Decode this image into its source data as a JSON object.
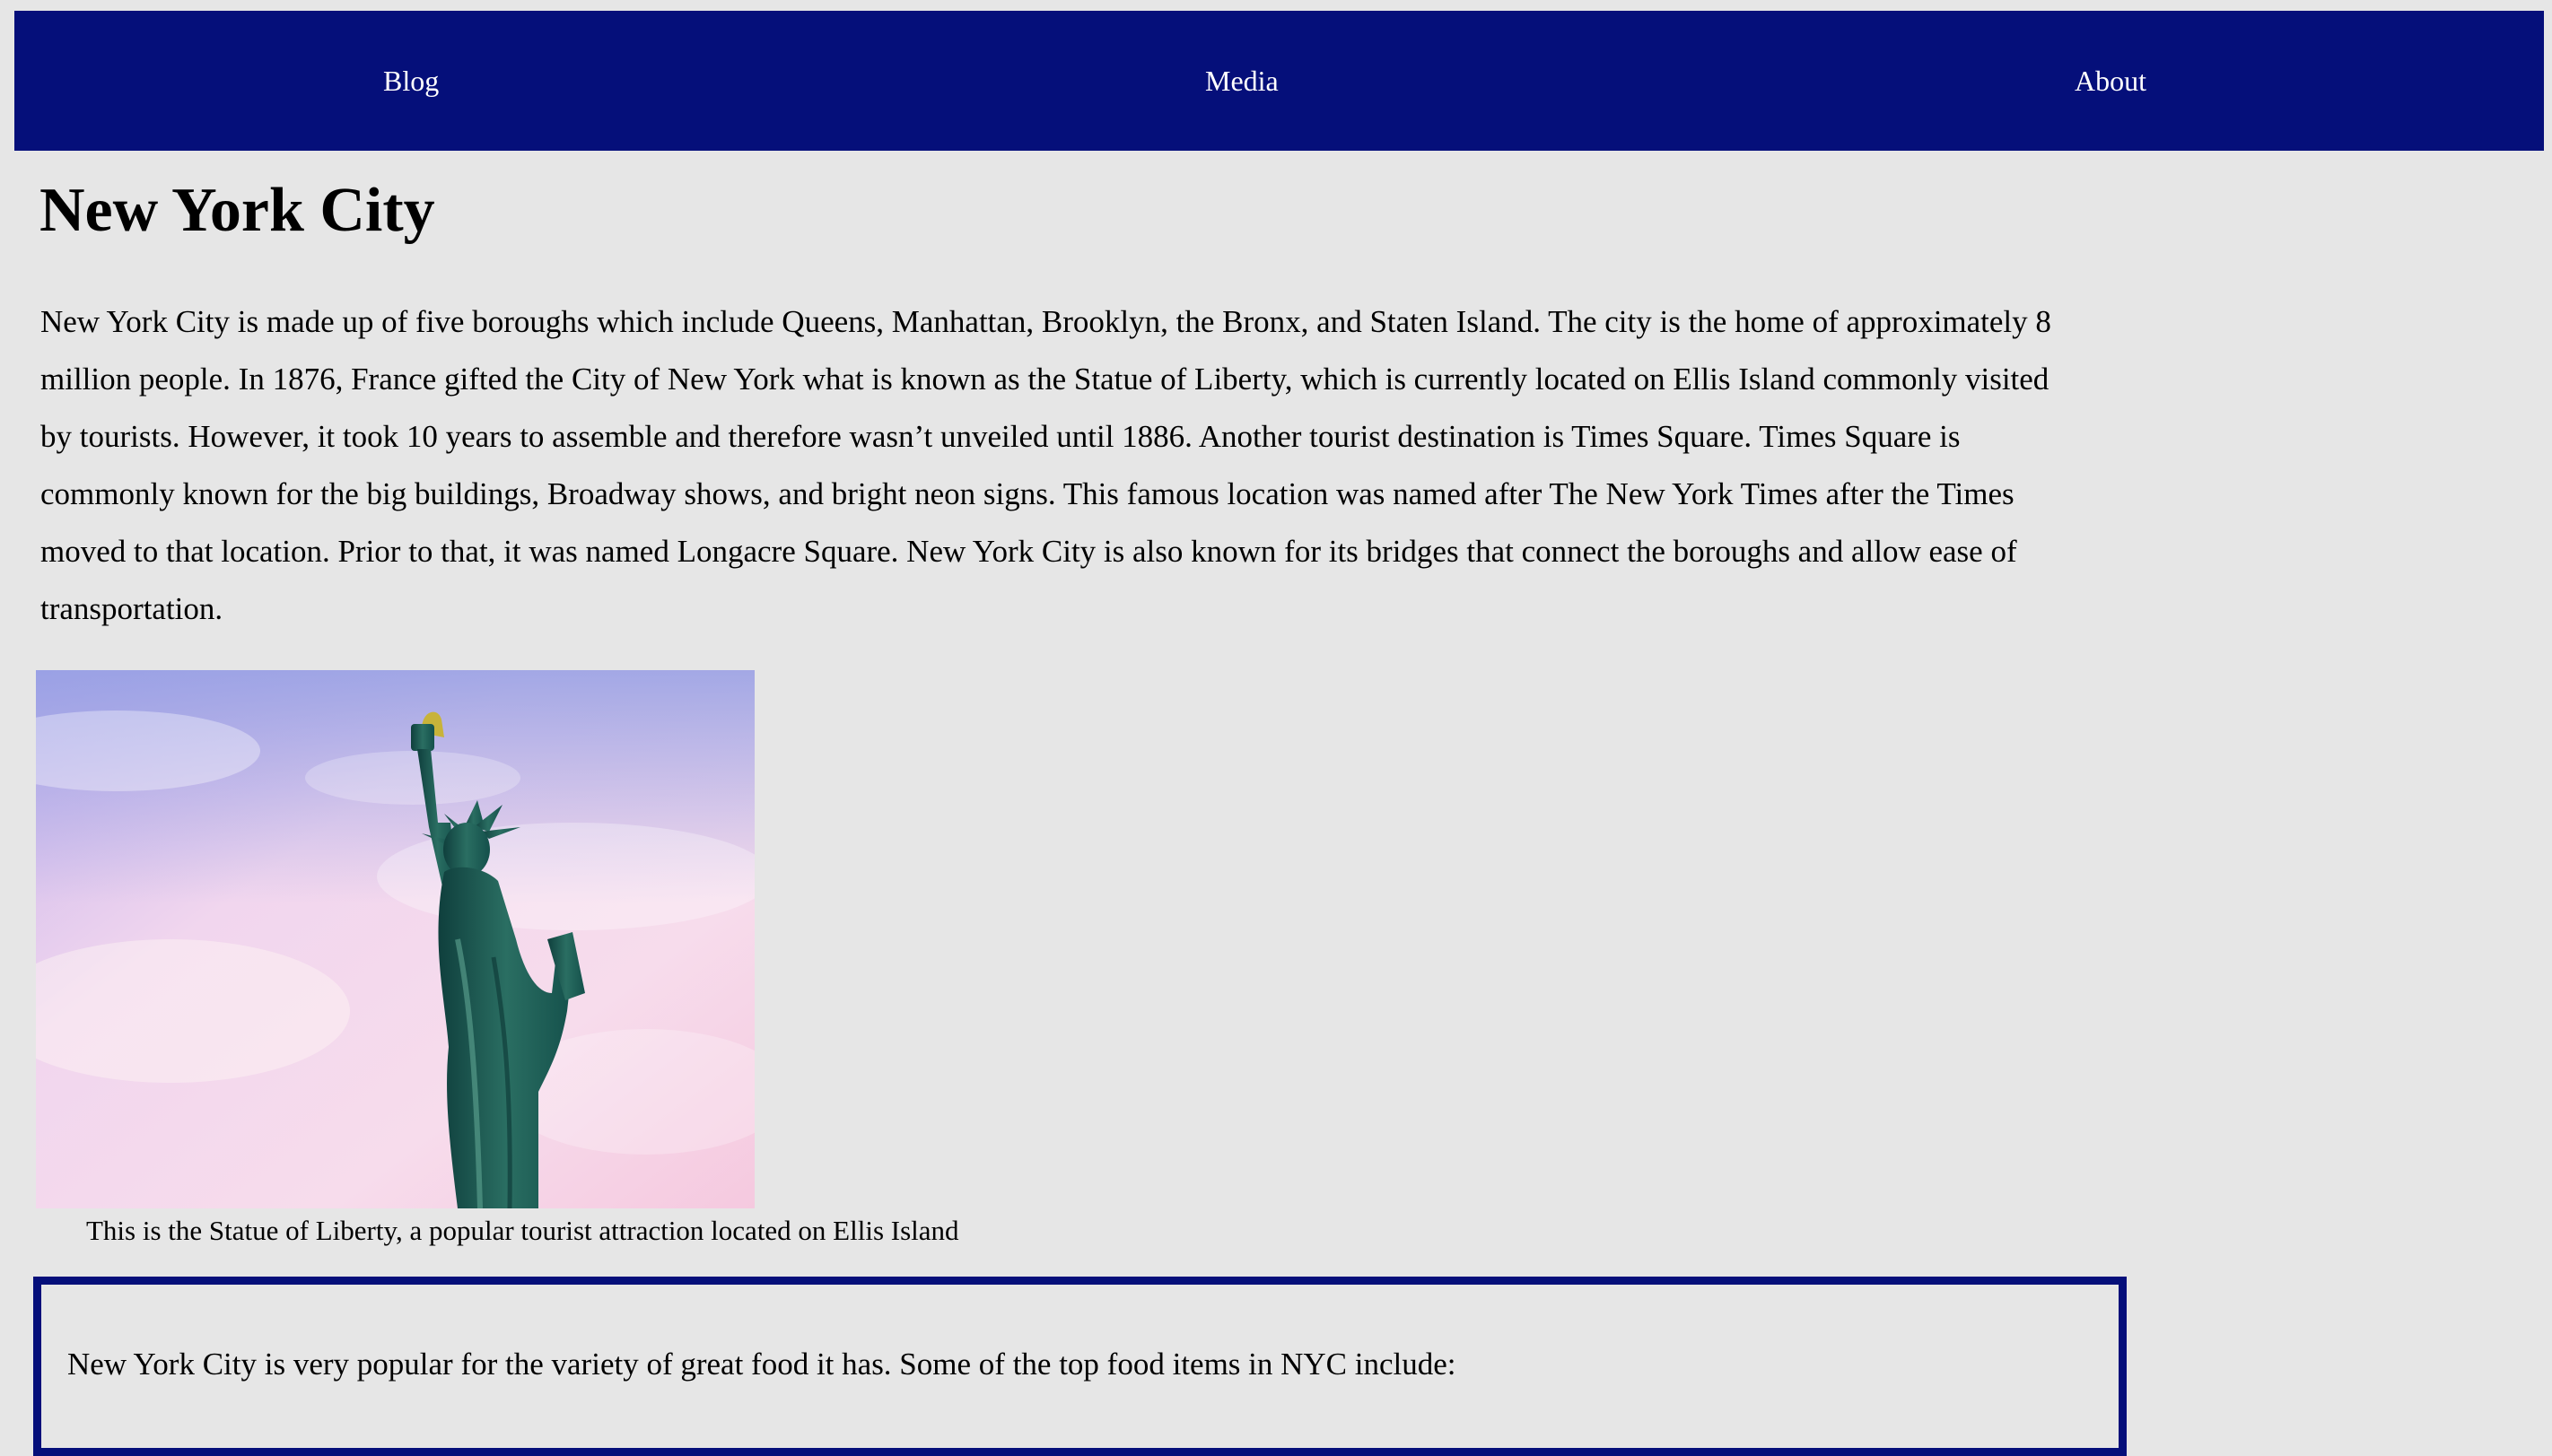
{
  "nav": {
    "items": [
      {
        "label": "Blog"
      },
      {
        "label": "Media"
      },
      {
        "label": "About"
      }
    ]
  },
  "article": {
    "title": "New York City",
    "intro": "New York City is made up of five boroughs which include Queens, Manhattan, Brooklyn, the Bronx, and Staten Island. The city is the home of approximately 8 million people. In 1876, France gifted the City of New York what is known as the Statue of Liberty, which is currently located on Ellis Island commonly visited by tourists. However, it took 10 years to assemble and therefore wasn’t unveiled until 1886. Another tourist destination is Times Square. Times Square is commonly known for the big buildings, Broadway shows, and bright neon signs. This famous location was named after The New York Times after the Times moved to that location. Prior to that, it was named Longacre Square. New York City is also known for its bridges that connect the boroughs and allow ease of transportation.",
    "figure": {
      "caption": "This is the Statue of Liberty, a popular tourist attraction located on Ellis Island"
    },
    "food": {
      "intro": "New York City is very popular for the variety of great food it has. Some of the top food items in NYC include:"
    }
  },
  "colors": {
    "nav_background": "#050f7a",
    "page_background": "#e6e6e6",
    "box_border": "#050f7a"
  }
}
